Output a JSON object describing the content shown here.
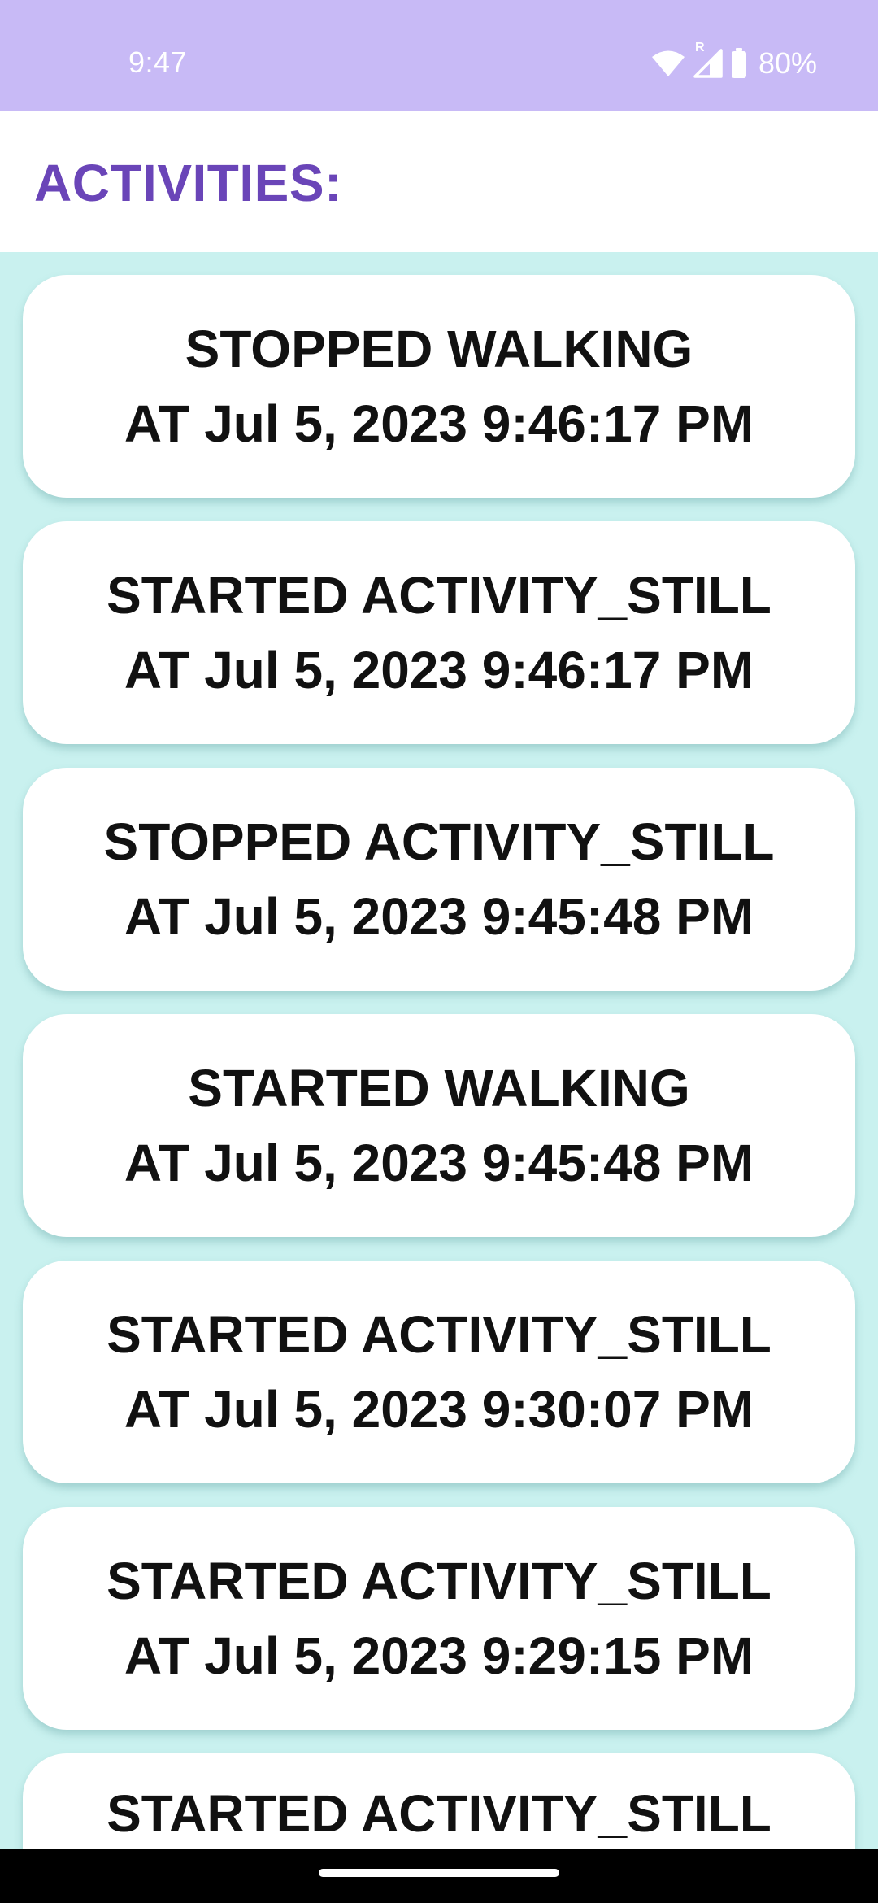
{
  "status_bar": {
    "time": "9:47",
    "roaming_indicator": "R",
    "battery_percent": "80%",
    "icons": [
      "wifi-icon",
      "cell-signal-icon",
      "battery-icon"
    ]
  },
  "header": {
    "title": "ACTIVITIES:"
  },
  "activities": [
    {
      "event": "STOPPED WALKING",
      "time": "AT Jul 5, 2023 9:46:17 PM"
    },
    {
      "event": "STARTED ACTIVITY_STILL",
      "time": "AT Jul 5, 2023 9:46:17 PM"
    },
    {
      "event": "STOPPED ACTIVITY_STILL",
      "time": "AT Jul 5, 2023 9:45:48 PM"
    },
    {
      "event": "STARTED WALKING",
      "time": "AT Jul 5, 2023 9:45:48 PM"
    },
    {
      "event": "STARTED ACTIVITY_STILL",
      "time": "AT Jul 5, 2023 9:30:07 PM"
    },
    {
      "event": "STARTED ACTIVITY_STILL",
      "time": "AT Jul 5, 2023 9:29:15 PM"
    },
    {
      "event": "STARTED ACTIVITY_STILL",
      "time": ""
    }
  ],
  "colors": {
    "status_bar_bg": "#c8baf6",
    "title_color": "#6a45b8",
    "list_bg": "#c9f1ef",
    "card_bg": "#ffffff",
    "nav_bar_bg": "#000000"
  }
}
